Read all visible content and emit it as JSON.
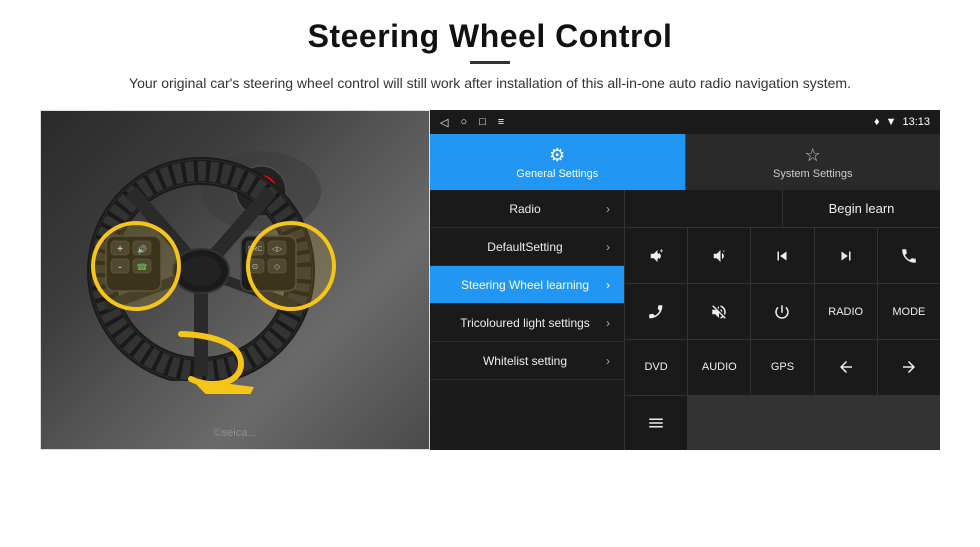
{
  "header": {
    "title": "Steering Wheel Control",
    "subtitle": "Your original car's steering wheel control will still work after installation of this all-in-one auto radio navigation system."
  },
  "status_bar": {
    "icons_left": [
      "◁",
      "○",
      "□",
      "≡"
    ],
    "time": "13:13",
    "signal_icons": [
      "♦",
      "▼"
    ]
  },
  "tabs": {
    "active": {
      "icon": "⚙",
      "label": "General Settings"
    },
    "inactive": {
      "icon": "☆",
      "label": "System Settings"
    }
  },
  "menu_items": [
    {
      "label": "Radio",
      "active": false
    },
    {
      "label": "DefaultSetting",
      "active": false
    },
    {
      "label": "Steering Wheel learning",
      "active": true
    },
    {
      "label": "Tricoloured light settings",
      "active": false
    },
    {
      "label": "Whitelist setting",
      "active": false
    }
  ],
  "right_panel": {
    "begin_learn_label": "Begin learn",
    "buttons_row1": [
      "🔇+",
      "🔇-",
      "⏮",
      "⏭",
      "📞"
    ],
    "buttons_row1_labels": [
      "vol+",
      "vol-",
      "prev",
      "next",
      "call"
    ],
    "buttons_row2_labels": [
      "hang",
      "mute",
      "power",
      "RADIO",
      "MODE"
    ],
    "buttons_row3_labels": [
      "DVD",
      "AUDIO",
      "GPS",
      "src+prev",
      "src+next"
    ]
  },
  "watermark": "©seica..."
}
